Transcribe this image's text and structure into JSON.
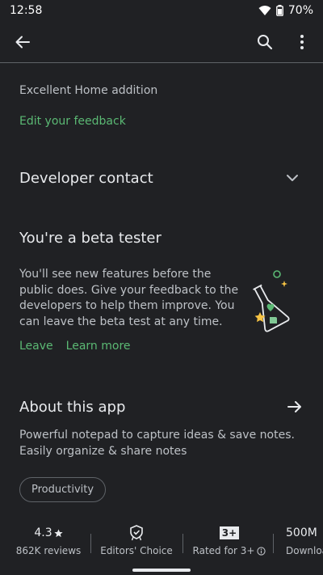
{
  "status_bar": {
    "time": "12:58",
    "battery": "70%"
  },
  "review": {
    "text": "Excellent Home addition",
    "edit_label": "Edit your feedback"
  },
  "developer_contact": {
    "title": "Developer contact"
  },
  "beta": {
    "title": "You're a beta tester",
    "description": "You'll see new features before the public does. Give your feedback to the developers to help them improve. You can leave the beta test at any time.",
    "leave_label": "Leave",
    "learn_more_label": "Learn more"
  },
  "about": {
    "title": "About this app",
    "description": "Powerful notepad to capture ideas & save notes. Easily organize & share notes",
    "category": "Productivity"
  },
  "stats": {
    "rating": "4.3",
    "reviews": "862K reviews",
    "editors_choice": "Editors' Choice",
    "rated_badge": "3+",
    "rated_label": "Rated for 3+",
    "downloads": "500M",
    "downloads_label": "Downloads"
  },
  "colors": {
    "background": "#202124",
    "accent": "#5bb974",
    "text": "#e8eaed",
    "muted": "#bdc1c6"
  },
  "icons": [
    "back-arrow-icon",
    "search-icon",
    "more-vert-icon",
    "chevron-down-icon",
    "arrow-right-icon",
    "star-icon",
    "editors-choice-icon",
    "info-icon",
    "wifi-icon",
    "battery-icon",
    "beta-flask-illustration"
  ]
}
